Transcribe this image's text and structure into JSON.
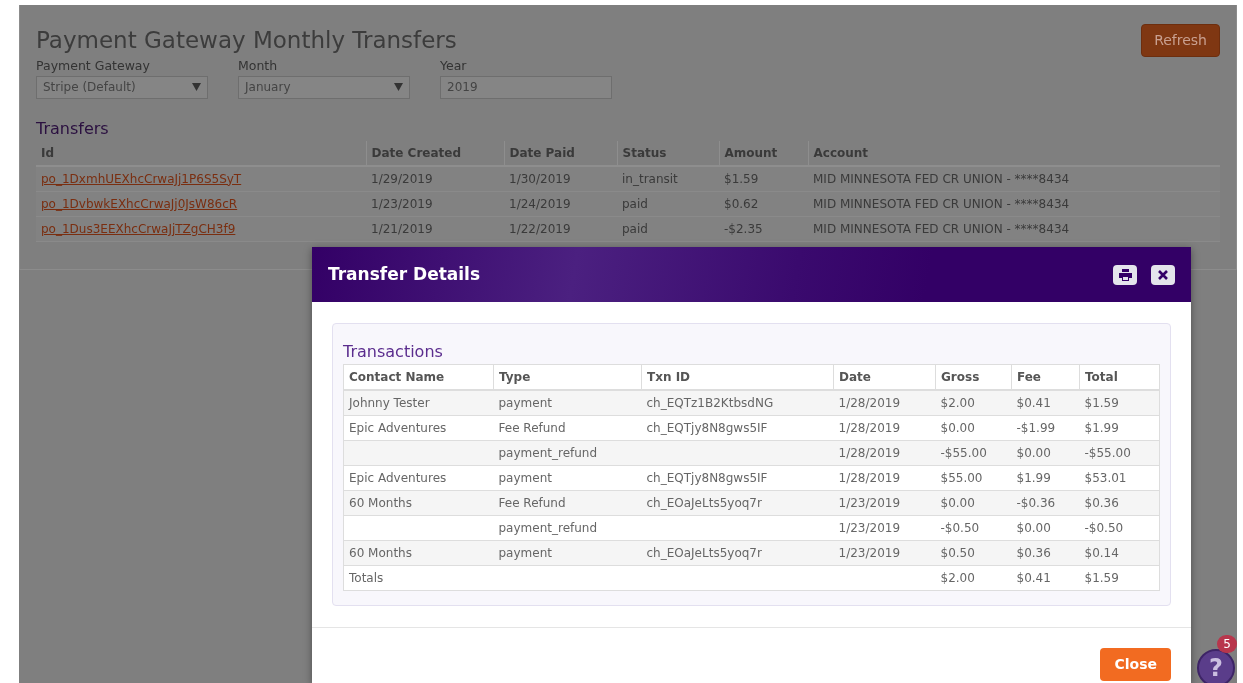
{
  "page": {
    "title": "Payment Gateway Monthly Transfers",
    "refresh_button": "Refresh",
    "filters": [
      {
        "label": "Payment Gateway",
        "value": "Stripe (Default)",
        "kind": "select"
      },
      {
        "label": "Month",
        "value": "January",
        "kind": "select"
      },
      {
        "label": "Year",
        "value": "2019",
        "kind": "text"
      }
    ],
    "transfers": {
      "title": "Transfers",
      "columns": [
        "Id",
        "Date Created",
        "Date Paid",
        "Status",
        "Amount",
        "Account"
      ],
      "rows": [
        {
          "id": "po_1DxmhUEXhcCrwaJj1P6S5SyT",
          "date_created": "1/29/2019",
          "date_paid": "1/30/2019",
          "status": "in_transit",
          "amount": "$1.59",
          "account": "MID MINNESOTA FED CR UNION - ****8434"
        },
        {
          "id": "po_1DvbwkEXhcCrwaJj0JsW86cR",
          "date_created": "1/23/2019",
          "date_paid": "1/24/2019",
          "status": "paid",
          "amount": "$0.62",
          "account": "MID MINNESOTA FED CR UNION - ****8434"
        },
        {
          "id": "po_1Dus3EEXhcCrwaJjTZgCH3f9",
          "date_created": "1/21/2019",
          "date_paid": "1/22/2019",
          "status": "paid",
          "amount": "-$2.35",
          "account": "MID MINNESOTA FED CR UNION - ****8434"
        }
      ]
    }
  },
  "modal": {
    "title": "Transfer Details",
    "section_title": "Transactions",
    "columns": [
      "Contact Name",
      "Type",
      "Txn ID",
      "Date",
      "Gross",
      "Fee",
      "Total"
    ],
    "rows": [
      {
        "contact": "Johnny Tester",
        "type": "payment",
        "txn_id": "ch_EQTz1B2KtbsdNG",
        "date": "1/28/2019",
        "gross": "$2.00",
        "fee": "$0.41",
        "total": "$1.59"
      },
      {
        "contact": "Epic Adventures",
        "type": "Fee Refund",
        "txn_id": "ch_EQTjy8N8gws5IF",
        "date": "1/28/2019",
        "gross": "$0.00",
        "fee": "-$1.99",
        "total": "$1.99"
      },
      {
        "type": "payment_refund",
        "date": "1/28/2019",
        "gross": "-$55.00",
        "fee": "$0.00",
        "total": "-$55.00"
      },
      {
        "contact": "Epic Adventures",
        "type": "payment",
        "txn_id": "ch_EQTjy8N8gws5IF",
        "date": "1/28/2019",
        "gross": "$55.00",
        "fee": "$1.99",
        "total": "$53.01"
      },
      {
        "contact": "60 Months",
        "type": "Fee Refund",
        "txn_id": "ch_EOaJeLts5yoq7r",
        "date": "1/23/2019",
        "gross": "$0.00",
        "fee": "-$0.36",
        "total": "$0.36"
      },
      {
        "type": "payment_refund",
        "date": "1/23/2019",
        "gross": "-$0.50",
        "fee": "$0.00",
        "total": "-$0.50"
      },
      {
        "contact": "60 Months",
        "type": "payment",
        "txn_id": "ch_EOaJeLts5yoq7r",
        "date": "1/23/2019",
        "gross": "$0.50",
        "fee": "$0.36",
        "total": "$0.14"
      },
      {
        "contact": "Totals",
        "gross": "$2.00",
        "fee": "$0.41",
        "total": "$1.59"
      }
    ],
    "close_button": "Close"
  },
  "help": {
    "icon": "?",
    "badge": "5"
  }
}
